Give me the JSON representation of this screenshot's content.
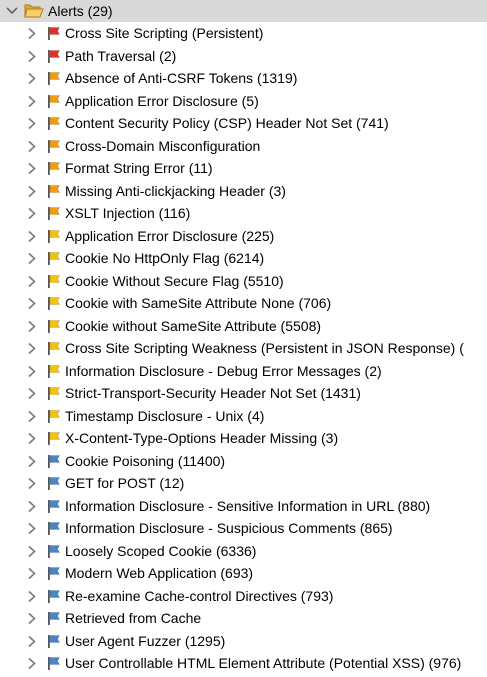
{
  "root": {
    "label": "Alerts (29)",
    "folder_color": "#f2c14e",
    "selected_bg": "#d9d9d9"
  },
  "flag_colors": {
    "high": "#e0322a",
    "medium": "#f39c12",
    "low": "#f4c20d",
    "info": "#4a86c5"
  },
  "alerts": [
    {
      "label": "Cross Site Scripting (Persistent)",
      "risk": "high"
    },
    {
      "label": "Path Traversal (2)",
      "risk": "high"
    },
    {
      "label": "Absence of Anti-CSRF Tokens (1319)",
      "risk": "medium"
    },
    {
      "label": "Application Error Disclosure (5)",
      "risk": "medium"
    },
    {
      "label": "Content Security Policy (CSP) Header Not Set (741)",
      "risk": "medium"
    },
    {
      "label": "Cross-Domain Misconfiguration",
      "risk": "medium"
    },
    {
      "label": "Format String Error (11)",
      "risk": "medium"
    },
    {
      "label": "Missing Anti-clickjacking Header (3)",
      "risk": "medium"
    },
    {
      "label": "XSLT Injection (116)",
      "risk": "medium"
    },
    {
      "label": "Application Error Disclosure (225)",
      "risk": "low"
    },
    {
      "label": "Cookie No HttpOnly Flag (6214)",
      "risk": "low"
    },
    {
      "label": "Cookie Without Secure Flag (5510)",
      "risk": "low"
    },
    {
      "label": "Cookie with SameSite Attribute None (706)",
      "risk": "low"
    },
    {
      "label": "Cookie without SameSite Attribute (5508)",
      "risk": "low"
    },
    {
      "label": "Cross Site Scripting Weakness (Persistent in JSON Response) (",
      "risk": "low"
    },
    {
      "label": "Information Disclosure - Debug Error Messages (2)",
      "risk": "low"
    },
    {
      "label": "Strict-Transport-Security Header Not Set (1431)",
      "risk": "low"
    },
    {
      "label": "Timestamp Disclosure - Unix (4)",
      "risk": "low"
    },
    {
      "label": "X-Content-Type-Options Header Missing (3)",
      "risk": "low"
    },
    {
      "label": "Cookie Poisoning (11400)",
      "risk": "info"
    },
    {
      "label": "GET for POST (12)",
      "risk": "info"
    },
    {
      "label": "Information Disclosure - Sensitive Information in URL (880)",
      "risk": "info"
    },
    {
      "label": "Information Disclosure - Suspicious Comments (865)",
      "risk": "info"
    },
    {
      "label": "Loosely Scoped Cookie (6336)",
      "risk": "info"
    },
    {
      "label": "Modern Web Application (693)",
      "risk": "info"
    },
    {
      "label": "Re-examine Cache-control Directives (793)",
      "risk": "info"
    },
    {
      "label": "Retrieved from Cache",
      "risk": "info"
    },
    {
      "label": "User Agent Fuzzer (1295)",
      "risk": "info"
    },
    {
      "label": "User Controllable HTML Element Attribute (Potential XSS) (976)",
      "risk": "info"
    }
  ]
}
